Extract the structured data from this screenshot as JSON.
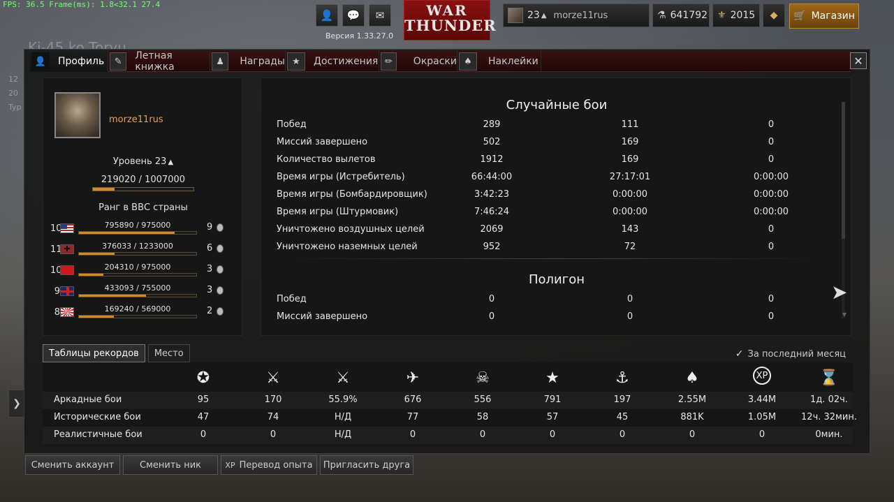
{
  "fps": "FPS: 36.5 Frame(ms): 1.8<32.1 27.4",
  "background": {
    "title": "Ki-45 ko Toryu",
    "left_lines": [
      "12",
      "20",
      "Typ"
    ]
  },
  "topbar": {
    "version": "Версия 1.33.27.0",
    "logo_line1": "WAR",
    "logo_line2": "THUNDER",
    "level": "23",
    "username": "morze11rus",
    "silver_lions": "641792",
    "golden_eagles": "2015",
    "shop_label": "Магазин",
    "icons": [
      "profile-icon",
      "chat-icon",
      "mail-icon",
      "silver-lions-icon",
      "golden-eagles-icon",
      "premium-icon",
      "cart-icon"
    ]
  },
  "tabs": [
    {
      "label": "Профиль",
      "icon": "profile-icon"
    },
    {
      "label": "Летная книжка",
      "icon": "logbook-icon"
    },
    {
      "label": "Награды",
      "icon": "medal-icon"
    },
    {
      "label": "Достижения",
      "icon": "star-icon"
    },
    {
      "label": "Окраски",
      "icon": "brush-icon"
    },
    {
      "label": "Наклейки",
      "icon": "spade-icon"
    }
  ],
  "profile": {
    "name": "morze11rus",
    "level_label": "Уровень 23",
    "exp": "219020 / 1007000",
    "exp_progress": 0.217,
    "rank_title": "Ранг в ВВС страны",
    "nations": [
      {
        "rank": "10",
        "flag": "usa",
        "exp": "795890 / 975000",
        "progress": 0.816,
        "medals": "9"
      },
      {
        "rank": "11",
        "flag": "germany",
        "exp": "376033 / 1233000",
        "progress": 0.305,
        "medals": "6"
      },
      {
        "rank": "10",
        "flag": "ussr",
        "exp": "204310 / 975000",
        "progress": 0.21,
        "medals": "3"
      },
      {
        "rank": "9",
        "flag": "britain",
        "exp": "433093 / 755000",
        "progress": 0.574,
        "medals": "3"
      },
      {
        "rank": "8",
        "flag": "japan",
        "exp": "169240 / 569000",
        "progress": 0.297,
        "medals": "2"
      }
    ]
  },
  "stats": {
    "random_title": "Случайные бои",
    "random_rows": [
      {
        "label": "Побед",
        "v1": "289",
        "v2": "111",
        "v3": "0"
      },
      {
        "label": "Миссий завершено",
        "v1": "502",
        "v2": "169",
        "v3": "0"
      },
      {
        "label": "Количество вылетов",
        "v1": "1912",
        "v2": "169",
        "v3": "0"
      },
      {
        "label": "Время игры (Истребитель)",
        "v1": "66:44:00",
        "v2": "27:17:01",
        "v3": "0:00:00"
      },
      {
        "label": "Время игры (Бомбардировщик)",
        "v1": "3:42:23",
        "v2": "0:00:00",
        "v3": "0:00:00"
      },
      {
        "label": "Время игры (Штурмовик)",
        "v1": "7:46:24",
        "v2": "0:00:00",
        "v3": "0:00:00"
      },
      {
        "label": "Уничтожено воздушных целей",
        "v1": "2069",
        "v2": "143",
        "v3": "0"
      },
      {
        "label": "Уничтожено наземных целей",
        "v1": "952",
        "v2": "72",
        "v3": "0"
      }
    ],
    "polygon_title": "Полигон",
    "polygon_rows": [
      {
        "label": "Побед",
        "v1": "0",
        "v2": "0",
        "v3": "0"
      },
      {
        "label": "Миссий завершено",
        "v1": "0",
        "v2": "0",
        "v3": "0"
      }
    ]
  },
  "leaderboard": {
    "tab_records": "Таблицы рекордов",
    "tab_place": "Место",
    "last_month": "За последний месяц",
    "column_icons": [
      "victories-icon",
      "missions-icon",
      "win-rate-icon",
      "air-kills-icon",
      "deaths-icon",
      "ground-kills-icon",
      "naval-kills-icon",
      "lions-earned-icon",
      "xp-icon",
      "time-icon"
    ],
    "rows": [
      {
        "label": "Аркадные бои",
        "values": [
          "95",
          "170",
          "55.9%",
          "676",
          "556",
          "791",
          "197",
          "2.55M",
          "3.44M",
          "1д. 02ч."
        ]
      },
      {
        "label": "Исторические бои",
        "values": [
          "47",
          "74",
          "Н/Д",
          "77",
          "58",
          "57",
          "45",
          "881K",
          "1.05M",
          "12ч. 32мин."
        ]
      },
      {
        "label": "Реалистичные бои",
        "values": [
          "0",
          "0",
          "Н/Д",
          "0",
          "0",
          "0",
          "0",
          "0",
          "0",
          "0мин."
        ]
      }
    ]
  },
  "bottom": {
    "change_account": "Сменить аккаунт",
    "change_nick": "Сменить ник",
    "transfer_exp": "Перевод опыта",
    "invite_friend": "Пригласить друга"
  },
  "colors": {
    "accent_orange": "#d08a28",
    "logo_red": "#8a1010",
    "shop_gold": "#a06818",
    "username_orange": "#e0a060"
  }
}
